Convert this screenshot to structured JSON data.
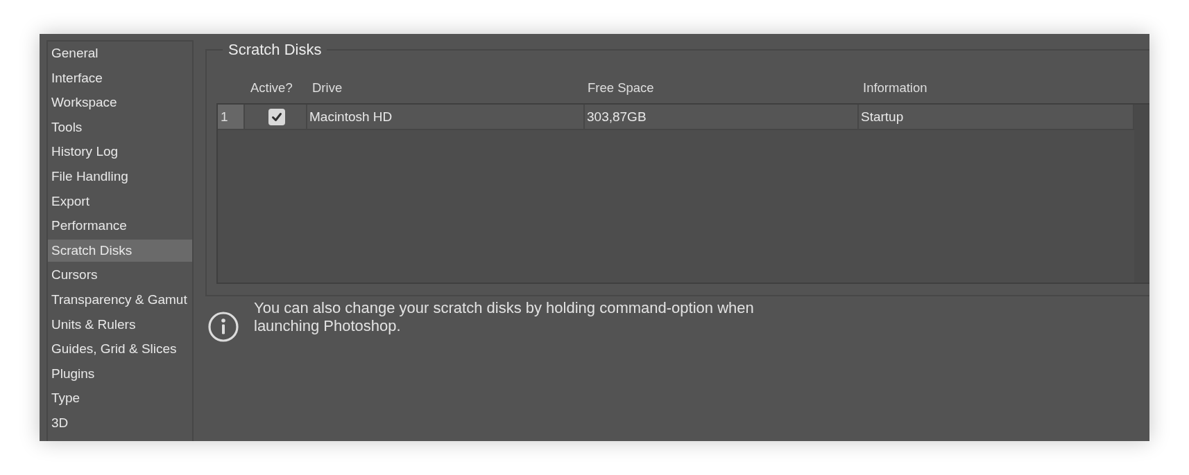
{
  "sidebar": {
    "items": [
      {
        "label": "General",
        "selected": false
      },
      {
        "label": "Interface",
        "selected": false
      },
      {
        "label": "Workspace",
        "selected": false
      },
      {
        "label": "Tools",
        "selected": false
      },
      {
        "label": "History Log",
        "selected": false
      },
      {
        "label": "File Handling",
        "selected": false
      },
      {
        "label": "Export",
        "selected": false
      },
      {
        "label": "Performance",
        "selected": false
      },
      {
        "label": "Scratch Disks",
        "selected": true
      },
      {
        "label": "Cursors",
        "selected": false
      },
      {
        "label": "Transparency & Gamut",
        "selected": false
      },
      {
        "label": "Units & Rulers",
        "selected": false
      },
      {
        "label": "Guides, Grid & Slices",
        "selected": false
      },
      {
        "label": "Plugins",
        "selected": false
      },
      {
        "label": "Type",
        "selected": false
      },
      {
        "label": "3D",
        "selected": false
      }
    ]
  },
  "scratch_disks": {
    "title": "Scratch Disks",
    "table": {
      "columns": [
        "Active?",
        "Drive",
        "Free Space",
        "Information"
      ],
      "rows": [
        {
          "index": "1",
          "active": true,
          "drive": "Macintosh HD",
          "free_space": "303,87GB",
          "information": "Startup"
        }
      ]
    }
  },
  "info": {
    "text": "You can also change your scratch disks by holding command-option when launching Photoshop."
  }
}
